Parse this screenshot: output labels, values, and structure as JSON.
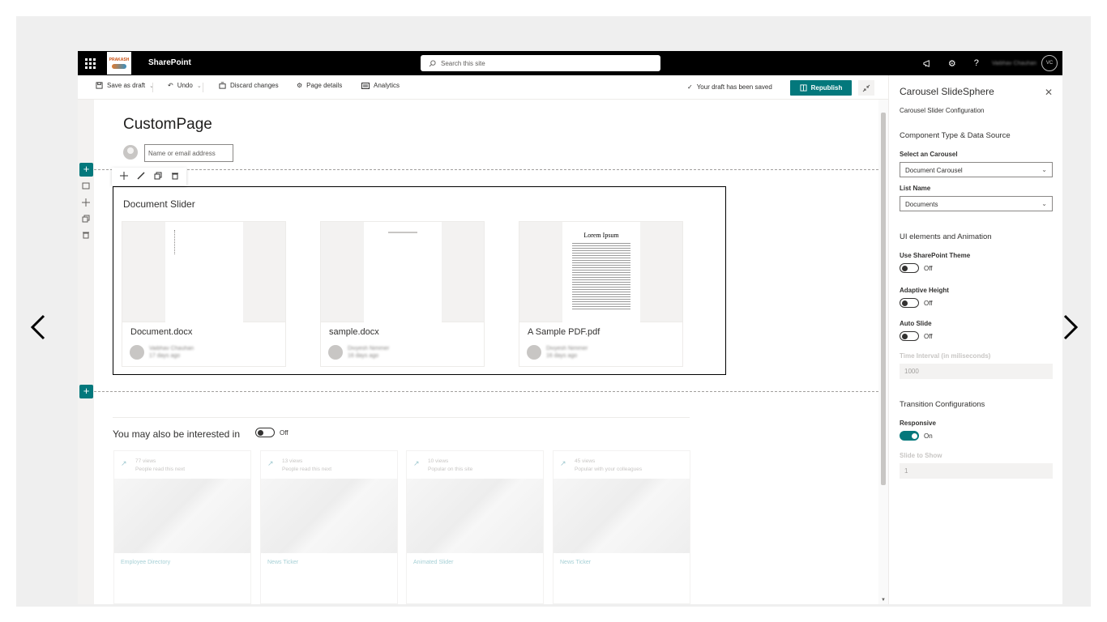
{
  "suite": {
    "app_name": "SharePoint",
    "logo_text": "PRAKASH",
    "search_placeholder": "Search this site",
    "user_name": "Vaibhav Chauhan",
    "user_initials": "VC",
    "icons": [
      "megaphone-icon",
      "gear-icon",
      "help-icon"
    ]
  },
  "toolbar": {
    "save_label": "Save as draft",
    "undo_label": "Undo",
    "discard_label": "Discard changes",
    "page_details_label": "Page details",
    "analytics_label": "Analytics",
    "saved_status": "Your draft has been saved",
    "republish_label": "Republish",
    "accent": "#03787c"
  },
  "page": {
    "title": "CustomPage",
    "author_placeholder": "Name or email address"
  },
  "document_slider": {
    "title": "Document Slider",
    "cards": [
      {
        "name": "Document.docx",
        "author": "Vaibhav Chauhan",
        "time": "17 days ago",
        "preview_heading": ""
      },
      {
        "name": "sample.docx",
        "author": "Divyesh Nimmer",
        "time": "16 days ago",
        "preview_heading": ""
      },
      {
        "name": "A Sample PDF.pdf",
        "author": "Divyesh Nimmer",
        "time": "16 days ago",
        "preview_heading": "Lorem Ipsum"
      }
    ]
  },
  "recommendations": {
    "title": "You may also be interested in",
    "toggle_state": "Off",
    "cards": [
      {
        "views": "77 views",
        "reason": "People read this next",
        "name": "Employee Directory"
      },
      {
        "views": "13 views",
        "reason": "People read this next",
        "name": "News Ticker"
      },
      {
        "views": "10 views",
        "reason": "Popular on this site",
        "name": "Animated Slider"
      },
      {
        "views": "45 views",
        "reason": "Popular with your colleagues",
        "name": "News Ticker"
      }
    ]
  },
  "pane": {
    "title": "Carousel SlideSphere",
    "subtitle": "Carousel Slider Configuration",
    "group1": "Component Type & Data Source",
    "carousel_label": "Select an Carousel",
    "carousel_value": "Document Carousel",
    "list_label": "List Name",
    "list_value": "Documents",
    "group2": "UI elements and Animation",
    "theme_label": "Use SharePoint Theme",
    "theme_state": "Off",
    "adaptive_label": "Adaptive Height",
    "adaptive_state": "Off",
    "autoslide_label": "Auto Slide",
    "autoslide_state": "Off",
    "interval_label": "Time Interval (in miliseconds)",
    "interval_value": "1000",
    "group3": "Transition Configurations",
    "responsive_label": "Responsive",
    "responsive_state": "On",
    "slide_show_label": "Slide to Show",
    "slide_show_value": "1"
  }
}
